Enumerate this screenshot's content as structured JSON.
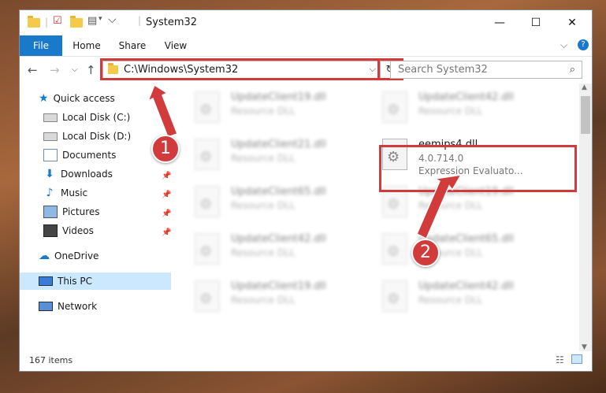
{
  "window": {
    "title": "System32",
    "controls": {
      "minimize": "—",
      "maximize": "☐",
      "close": "✕"
    }
  },
  "ribbon": {
    "tabs": [
      "File",
      "Home",
      "Share",
      "View"
    ],
    "help": "?"
  },
  "address": {
    "path": "C:\\Windows\\System32",
    "search_placeholder": "Search System32"
  },
  "sidebar": {
    "quick_access": "Quick access",
    "items": [
      {
        "label": "Local Disk (C:)",
        "icon": "drive-icon",
        "pinned": true
      },
      {
        "label": "Local Disk (D:)",
        "icon": "drive-icon",
        "pinned": false
      },
      {
        "label": "Documents",
        "icon": "documents-icon",
        "pinned": true
      },
      {
        "label": "Downloads",
        "icon": "downloads-icon",
        "pinned": true
      },
      {
        "label": "Music",
        "icon": "music-icon",
        "pinned": true
      },
      {
        "label": "Pictures",
        "icon": "pictures-icon",
        "pinned": true
      },
      {
        "label": "Videos",
        "icon": "videos-icon",
        "pinned": true
      }
    ],
    "onedrive": "OneDrive",
    "this_pc": "This PC",
    "network": "Network"
  },
  "files": [
    {
      "name": "UpdateClient19.dll",
      "desc": "Resource DLL",
      "blurred": true
    },
    {
      "name": "UpdateClient42.dll",
      "desc": "Resource DLL",
      "blurred": true
    },
    {
      "name": "UpdateClient21.dll",
      "desc": "Resource DLL",
      "blurred": true
    },
    {
      "name": "eemips4.dll",
      "version": "4.0.714.0",
      "desc": "Expression Evaluato...",
      "blurred": false
    },
    {
      "name": "UpdateClient65.dll",
      "desc": "Resource DLL",
      "blurred": true
    },
    {
      "name": "UpdateClient19.dll",
      "desc": "Resource DLL",
      "blurred": true
    },
    {
      "name": "UpdateClient42.dll",
      "desc": "Resource DLL",
      "blurred": true
    },
    {
      "name": "UpdateClient65.dll",
      "desc": "Resource DLL",
      "blurred": true
    },
    {
      "name": "UpdateClient19.dll",
      "desc": "Resource DLL",
      "blurred": true
    },
    {
      "name": "UpdateClient42.dll",
      "desc": "Resource DLL",
      "blurred": true
    }
  ],
  "status": {
    "count": "167 items"
  },
  "annotations": {
    "step1": "1",
    "step2": "2"
  },
  "colors": {
    "accent": "#1979ca",
    "highlight": "#d23b3b",
    "selected": "#cce8ff"
  }
}
